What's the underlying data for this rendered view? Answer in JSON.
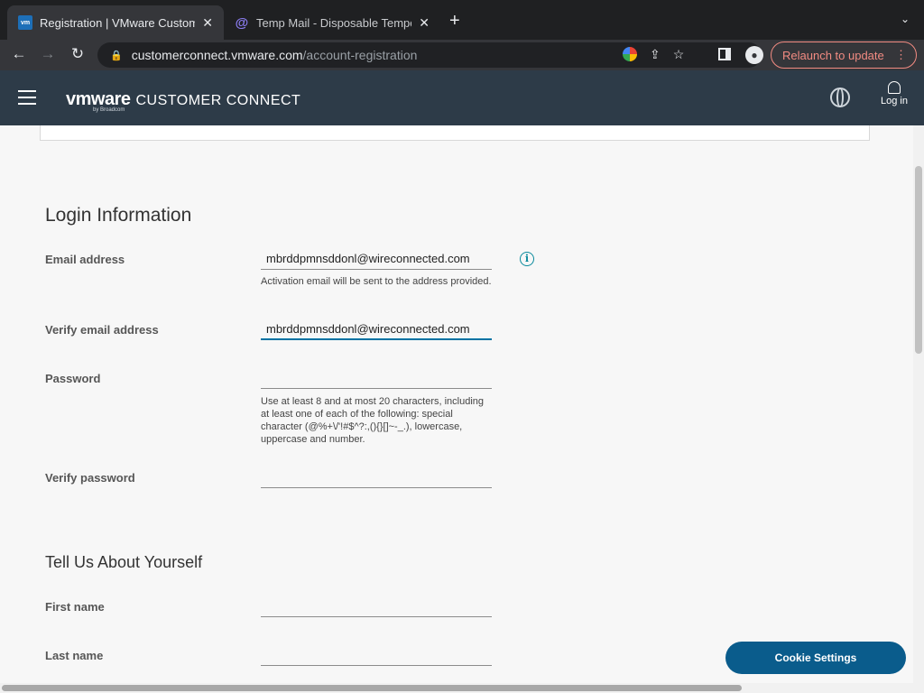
{
  "browser": {
    "tabs": [
      {
        "title": "Registration | VMware Custome",
        "favicon": "vmware-icon",
        "active": true
      },
      {
        "title": "Temp Mail - Disposable Tempo",
        "favicon": "at-sign-icon",
        "active": false
      }
    ],
    "url_host": "customerconnect.vmware.com",
    "url_path": "/account-registration",
    "relaunch_label": "Relaunch to update"
  },
  "header": {
    "logo_brand": "vmware",
    "logo_product": "CUSTOMER CONNECT",
    "logo_by": "by Broadcom",
    "login_label": "Log in"
  },
  "login_section": {
    "title": "Login Information",
    "email_label": "Email address",
    "email_value": "mbrddpmnsddonl@wireconnected.com",
    "email_help": "Activation email will be sent to the address provided.",
    "verify_email_label": "Verify email address",
    "verify_email_value": "mbrddpmnsddonl@wireconnected.com",
    "password_label": "Password",
    "password_help": "Use at least 8 and at most 20 characters, including at least one of each of the following: special character (@%+\\/'!#$^?:,(){}[]~-_.), lowercase, uppercase and number.",
    "verify_password_label": "Verify password"
  },
  "about_section": {
    "title": "Tell Us About Yourself",
    "first_name_label": "First name",
    "last_name_label": "Last name"
  },
  "cookie_button_label": "Cookie Settings",
  "colors": {
    "header_bg": "#2d3b48",
    "accent": "#0072a3",
    "cookie_button": "#0a5c8c"
  }
}
